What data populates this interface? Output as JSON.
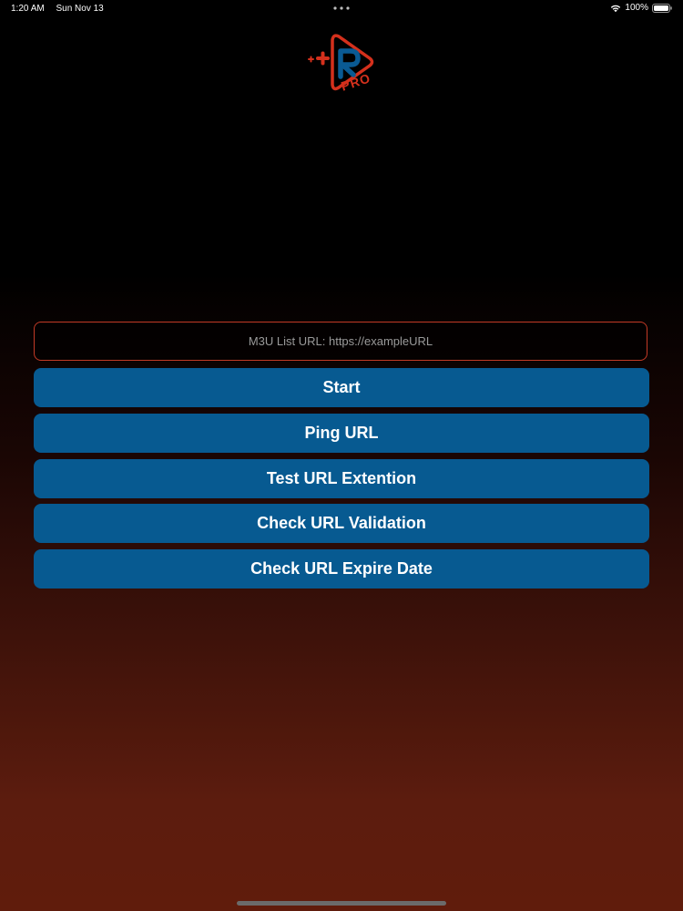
{
  "status_bar": {
    "time": "1:20 AM",
    "date": "Sun Nov 13",
    "battery": "100%"
  },
  "url_field": {
    "placeholder": "M3U List URL: https://exampleURL"
  },
  "buttons": [
    {
      "label": "Start"
    },
    {
      "label": "Ping URL"
    },
    {
      "label": "Test URL Extention"
    },
    {
      "label": "Check URL Validation"
    },
    {
      "label": "Check URL Expire Date"
    }
  ],
  "logo": {
    "text": "PRO",
    "icon": "play-plus-logo"
  },
  "colors": {
    "button": "#075a91",
    "accent_red": "#c23a26"
  }
}
